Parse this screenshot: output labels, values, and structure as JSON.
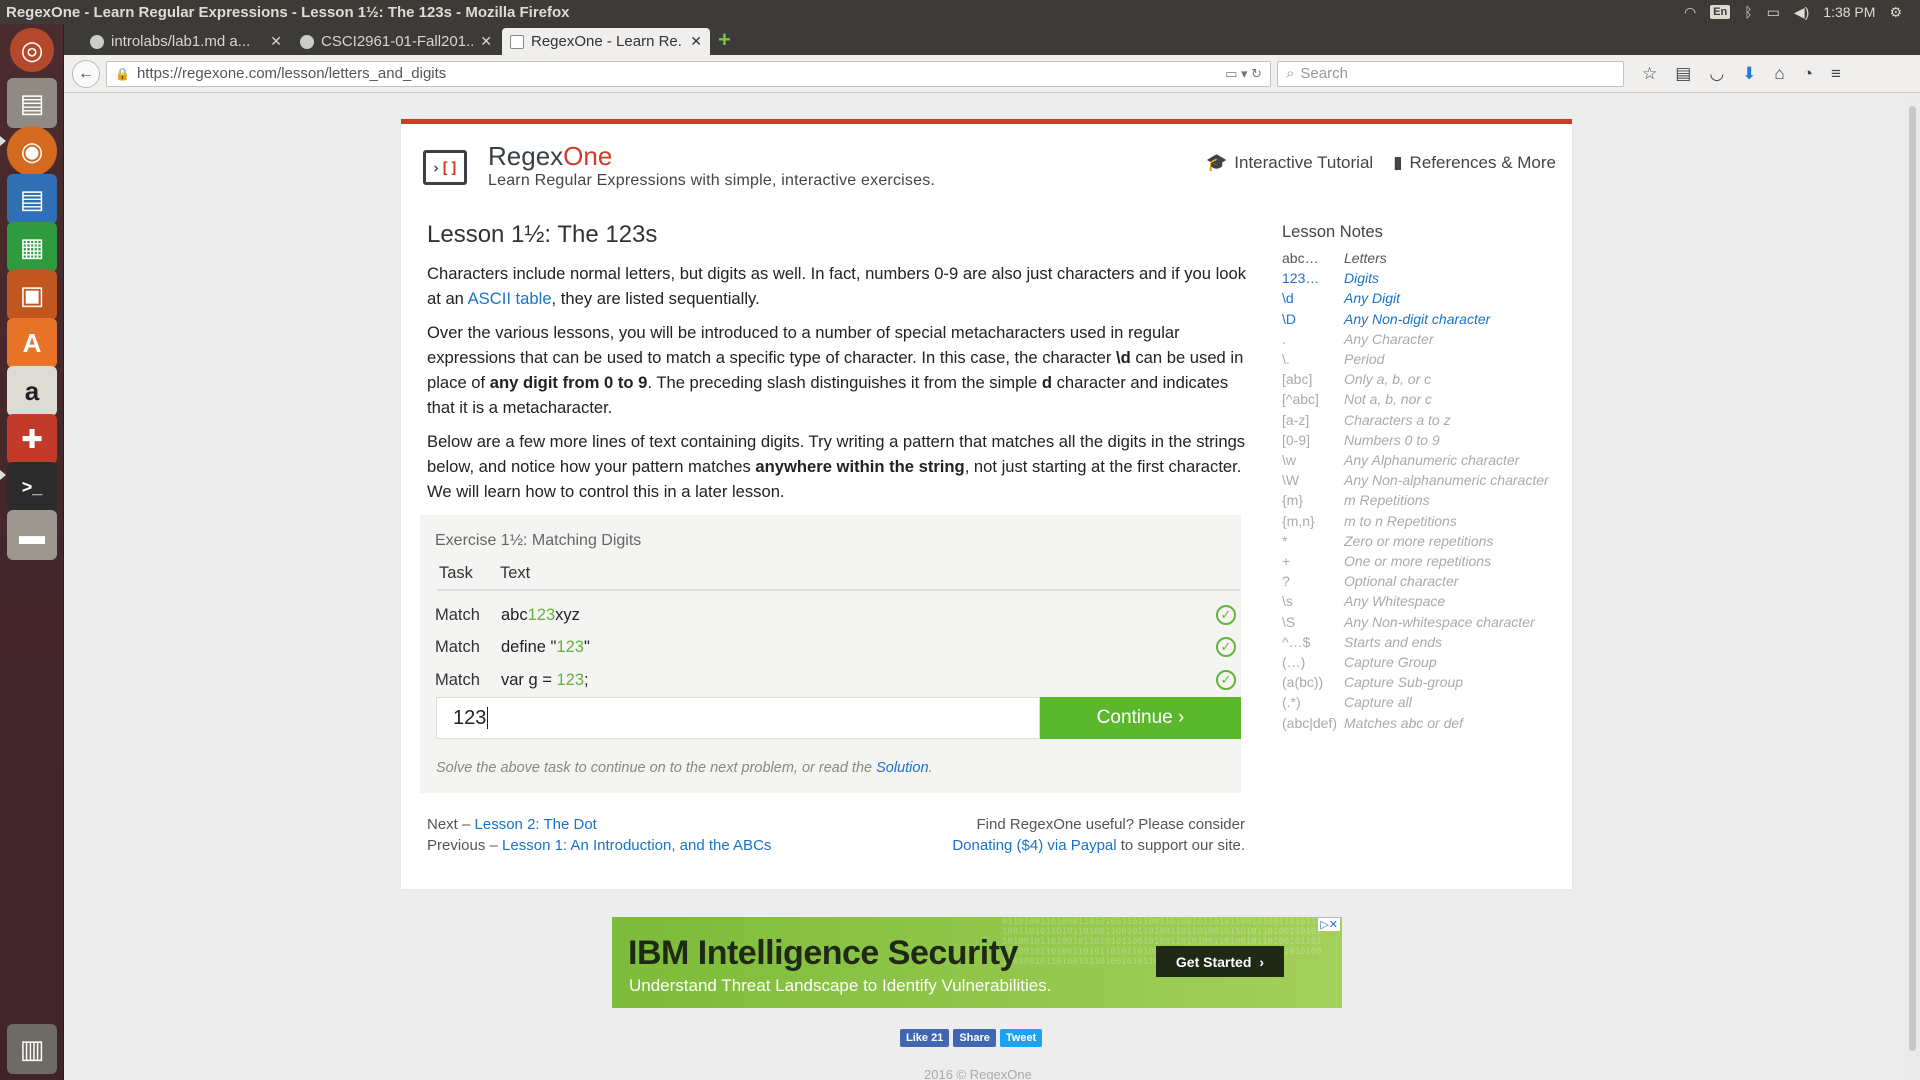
{
  "window": {
    "title": "RegexOne - Learn Regular Expressions - Lesson 1½: The 123s - Mozilla Firefox",
    "tray_lang": "En",
    "clock": "1:38 PM"
  },
  "tabs": [
    {
      "label": "introlabs/lab1.md a..."
    },
    {
      "label": "CSCI2961-01-Fall201..."
    },
    {
      "label": "RegexOne - Learn Re..."
    }
  ],
  "nav": {
    "url": "https://regexone.com/lesson/letters_and_digits",
    "search_placeholder": "Search"
  },
  "site": {
    "brand_main": "Regex",
    "brand_accent": "One",
    "tagline": "Learn Regular Expressions with simple, interactive exercises.",
    "nav_tutorial": "Interactive Tutorial",
    "nav_references": "References & More"
  },
  "lesson": {
    "title": "Lesson 1½: The 123s",
    "p1_a": "Characters include normal letters, but digits as well. In fact, numbers 0-9 are also just characters and if you look at an ",
    "p1_link": "ASCII table",
    "p1_b": ", they are listed sequentially.",
    "p2_a": "Over the various lessons, you will be introduced to a number of special metacharacters used in regular expressions that can be used to match a specific type of character. In this case, the character ",
    "p2_code": "\\d",
    "p2_b": " can be used in place of ",
    "p2_bold": "any digit from 0 to 9",
    "p2_c": ". The preceding slash distinguishes it from the simple ",
    "p2_d": "d",
    "p2_e": " character and indicates that it is a metacharacter.",
    "p3_a": "Below are a few more lines of text containing digits. Try writing a pattern that matches all the digits in the strings below, and notice how your pattern matches ",
    "p3_bold": "anywhere within the string",
    "p3_b": ", not just starting at the first character. We will learn how to control this in a later lesson."
  },
  "exercise": {
    "title": "Exercise 1½: Matching Digits",
    "col_task": "Task",
    "col_text": "Text",
    "rows": [
      {
        "task": "Match",
        "pre": "abc",
        "match": "123",
        "post": "xyz"
      },
      {
        "task": "Match",
        "pre": "define \"",
        "match": "123",
        "post": "\""
      },
      {
        "task": "Match",
        "pre": "var g = ",
        "match": "123",
        "post": ";"
      }
    ],
    "input_value": "123",
    "continue_label": "Continue ›",
    "hint_a": "Solve the above task to continue on to the next problem, or read the ",
    "hint_link": "Solution",
    "hint_b": "."
  },
  "footer": {
    "next_prefix": "Next – ",
    "next_link": "Lesson 2: The Dot",
    "prev_prefix": "Previous – ",
    "prev_link": "Lesson 1: An Introduction, and the ABCs",
    "useful": "Find RegexOne useful? Please consider",
    "donate_link": "Donating ($4) via Paypal",
    "donate_suffix": " to support our site."
  },
  "notes": {
    "title": "Lesson Notes",
    "items": [
      {
        "k": "abc…",
        "v": "Letters",
        "state": "done"
      },
      {
        "k": "123…",
        "v": "Digits",
        "state": "current"
      },
      {
        "k": "\\d",
        "v": "Any Digit",
        "state": "current"
      },
      {
        "k": "\\D",
        "v": "Any Non-digit character",
        "state": "current"
      },
      {
        "k": ".",
        "v": "Any Character",
        "state": "todo"
      },
      {
        "k": "\\.",
        "v": "Period",
        "state": "todo"
      },
      {
        "k": "[abc]",
        "v": "Only a, b, or c",
        "state": "todo"
      },
      {
        "k": "[^abc]",
        "v": "Not a, b, nor c",
        "state": "todo"
      },
      {
        "k": "[a-z]",
        "v": "Characters a to z",
        "state": "todo"
      },
      {
        "k": "[0-9]",
        "v": "Numbers 0 to 9",
        "state": "todo"
      },
      {
        "k": "\\w",
        "v": "Any Alphanumeric character",
        "state": "todo"
      },
      {
        "k": "\\W",
        "v": "Any Non-alphanumeric character",
        "state": "todo"
      },
      {
        "k": "{m}",
        "v": "m Repetitions",
        "state": "todo"
      },
      {
        "k": "{m,n}",
        "v": "m to n Repetitions",
        "state": "todo"
      },
      {
        "k": "*",
        "v": "Zero or more repetitions",
        "state": "todo"
      },
      {
        "k": "+",
        "v": "One or more repetitions",
        "state": "todo"
      },
      {
        "k": "?",
        "v": "Optional character",
        "state": "todo"
      },
      {
        "k": "\\s",
        "v": "Any Whitespace",
        "state": "todo"
      },
      {
        "k": "\\S",
        "v": "Any Non-whitespace character",
        "state": "todo"
      },
      {
        "k": "^…$",
        "v": "Starts and ends",
        "state": "todo"
      },
      {
        "k": "(…)",
        "v": "Capture Group",
        "state": "todo"
      },
      {
        "k": "(a(bc))",
        "v": "Capture Sub-group",
        "state": "todo"
      },
      {
        "k": "(.*)",
        "v": "Capture all",
        "state": "todo"
      },
      {
        "k": "(abc|def)",
        "v": "Matches abc or def",
        "state": "todo"
      }
    ]
  },
  "ad": {
    "title": "IBM Intelligence Security",
    "subtitle": "Understand Threat Landscape to Identify Vulnerabilities.",
    "button": "Get Started"
  },
  "social": {
    "like": "Like 21",
    "share": "Share",
    "tweet": "Tweet"
  },
  "copyright": "2016 © RegexOne"
}
